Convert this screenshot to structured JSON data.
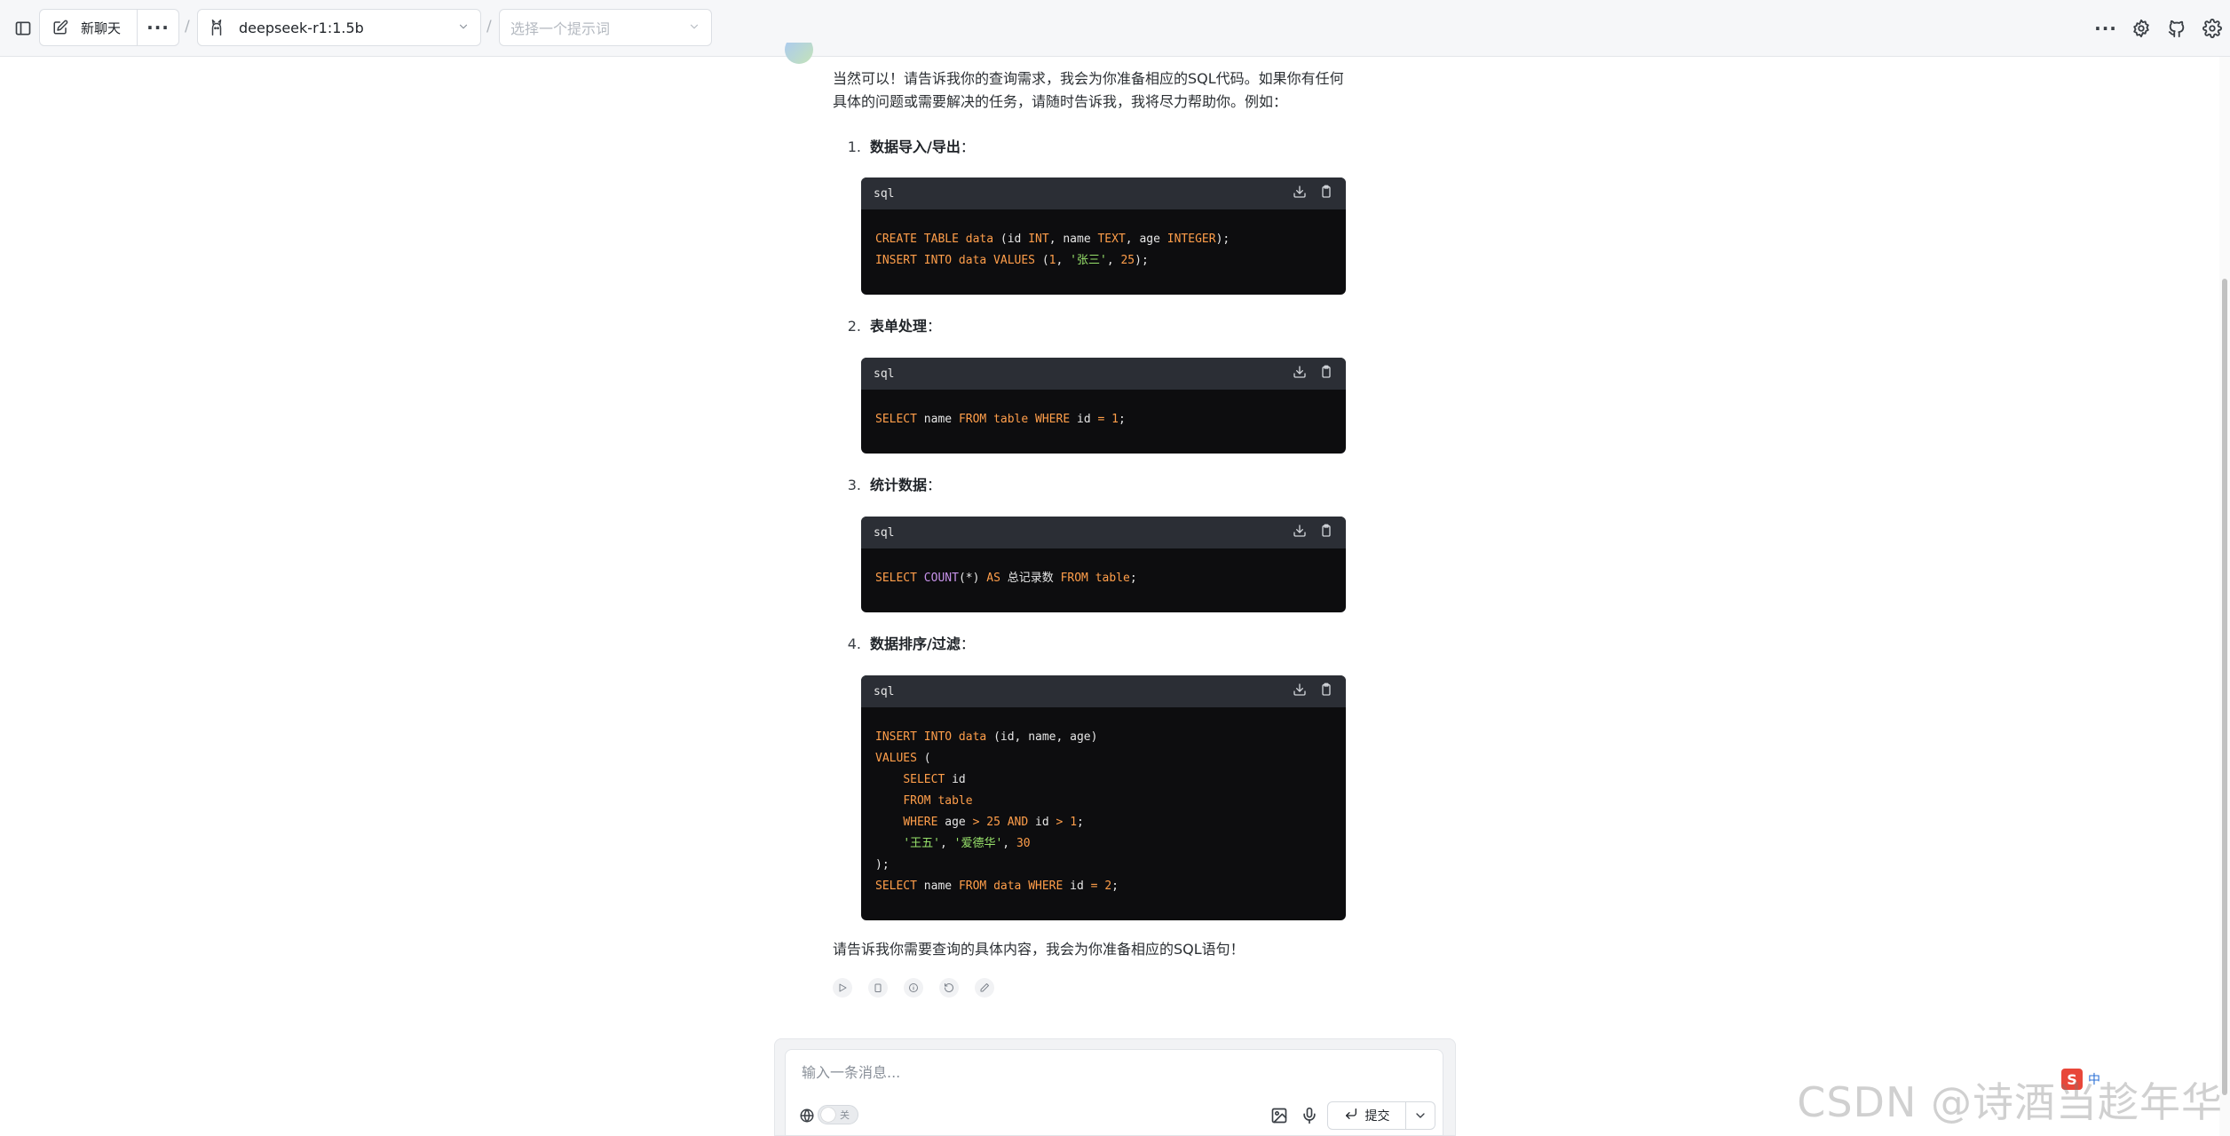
{
  "topbar": {
    "new_chat_label": "新聊天",
    "separator": "/",
    "model_name": "deepseek-r1:1.5b",
    "prompt_placeholder": "选择一个提示词"
  },
  "message": {
    "intro": "当然可以！请告诉我你的查询需求，我会为你准备相应的SQL代码。如果你有任何具体的问题或需要解决的任务，请随时告诉我，我将尽力帮助你。例如：",
    "items": [
      {
        "number": "1.",
        "title": "数据导入/导出",
        "suffix": "："
      },
      {
        "number": "2.",
        "title": "表单处理",
        "suffix": "："
      },
      {
        "number": "3.",
        "title": "统计数据",
        "suffix": "："
      },
      {
        "number": "4.",
        "title": "数据排序/过滤",
        "suffix": "："
      }
    ],
    "code_lang": "sql",
    "outro": "请告诉我你需要查询的具体内容，我会为你准备相应的SQL语句！"
  },
  "code_blocks": [
    {
      "lang": "sql",
      "lines": [
        [
          [
            "kw",
            "CREATE TABLE data "
          ],
          [
            "tx",
            "(id "
          ],
          [
            "kw",
            "INT"
          ],
          [
            "tx",
            ", name "
          ],
          [
            "kw",
            "TEXT"
          ],
          [
            "tx",
            ", age "
          ],
          [
            "kw",
            "INTEGER"
          ],
          [
            "tx",
            ");"
          ]
        ],
        [
          [
            "kw",
            "INSERT INTO data VALUES "
          ],
          [
            "tx",
            "("
          ],
          [
            "nm",
            "1"
          ],
          [
            "tx",
            ", "
          ],
          [
            "str",
            "'张三'"
          ],
          [
            "tx",
            ", "
          ],
          [
            "nm",
            "25"
          ],
          [
            "tx",
            ");"
          ]
        ]
      ]
    },
    {
      "lang": "sql",
      "lines": [
        [
          [
            "kw",
            "SELECT "
          ],
          [
            "tx",
            "name "
          ],
          [
            "kw",
            "FROM table WHERE "
          ],
          [
            "tx",
            "id "
          ],
          [
            "kw",
            "= "
          ],
          [
            "nm",
            "1"
          ],
          [
            "tx",
            ";"
          ]
        ]
      ]
    },
    {
      "lang": "sql",
      "lines": [
        [
          [
            "kw",
            "SELECT "
          ],
          [
            "fn",
            "COUNT"
          ],
          [
            "tx",
            "(*) "
          ],
          [
            "kw",
            "AS "
          ],
          [
            "tx",
            "总记录数 "
          ],
          [
            "kw",
            "FROM table"
          ],
          [
            "tx",
            ";"
          ]
        ]
      ]
    },
    {
      "lang": "sql",
      "lines": [
        [
          [
            "kw",
            "INSERT INTO data "
          ],
          [
            "tx",
            "(id, name, age)"
          ]
        ],
        [
          [
            "kw",
            "VALUES "
          ],
          [
            "tx",
            "("
          ]
        ],
        [
          [
            "tx",
            "    "
          ],
          [
            "kw",
            "SELECT "
          ],
          [
            "tx",
            "id"
          ]
        ],
        [
          [
            "tx",
            "    "
          ],
          [
            "kw",
            "FROM table"
          ]
        ],
        [
          [
            "tx",
            "    "
          ],
          [
            "kw",
            "WHERE "
          ],
          [
            "tx",
            "age "
          ],
          [
            "kw",
            "> "
          ],
          [
            "nm",
            "25 "
          ],
          [
            "kw",
            "AND "
          ],
          [
            "tx",
            "id "
          ],
          [
            "kw",
            "> "
          ],
          [
            "nm",
            "1"
          ],
          [
            "tx",
            ";"
          ]
        ],
        [
          [
            "tx",
            "    "
          ],
          [
            "str",
            "'王五'"
          ],
          [
            "tx",
            ", "
          ],
          [
            "str",
            "'爱德华'"
          ],
          [
            "tx",
            ", "
          ],
          [
            "nm",
            "30"
          ]
        ],
        [
          [
            "tx",
            ");"
          ]
        ],
        [
          [
            "kw",
            "SELECT "
          ],
          [
            "tx",
            "name "
          ],
          [
            "kw",
            "FROM data WHERE "
          ],
          [
            "tx",
            "id "
          ],
          [
            "kw",
            "= "
          ],
          [
            "nm",
            "2"
          ],
          [
            "tx",
            ";"
          ]
        ]
      ]
    }
  ],
  "composer": {
    "placeholder": "输入一条消息...",
    "toggle_label": "关",
    "submit_label": "提交"
  },
  "watermark": "CSDN @诗酒当趁年华",
  "ime_text": "中",
  "colors": {
    "code_bg": "#0d0d0f",
    "code_header_bg": "#2b2e35",
    "keyword": "#ff9e4a",
    "function": "#c792ea",
    "string": "#98e26b"
  },
  "icons": [
    "sidebar-toggle-icon",
    "edit-icon",
    "more-icon",
    "ollama-icon",
    "chevron-down-icon",
    "settings-icon",
    "github-icon",
    "download-icon",
    "copy-icon",
    "play-icon",
    "delete-icon",
    "info-icon",
    "regenerate-icon",
    "pencil-icon",
    "globe-icon",
    "image-icon",
    "mic-icon",
    "enter-icon"
  ]
}
